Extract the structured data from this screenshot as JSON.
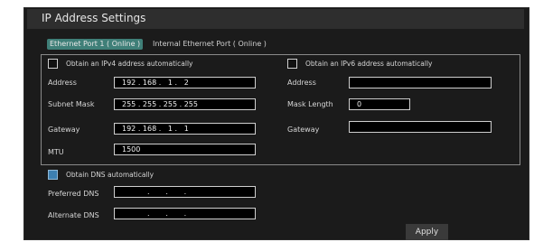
{
  "title": "IP Address Settings",
  "tabs": [
    {
      "label": "Ethernet Port 1 ( Online )",
      "active": true
    },
    {
      "label": "Internal Ethernet Port ( Online )",
      "active": false
    }
  ],
  "ipv4": {
    "auto_label": "Obtain an IPv4 address automatically",
    "auto_checked": false,
    "address_label": "Address",
    "address_value": "192 . 168 .   1 .   2",
    "mask_label": "Subnet Mask",
    "mask_value": "255 . 255 . 255 . 255",
    "gateway_label": "Gateway",
    "gateway_value": "192 . 168 .   1 .   1",
    "mtu_label": "MTU",
    "mtu_value": "1500"
  },
  "ipv6": {
    "auto_label": "Obtain an IPv6 address automatically",
    "auto_checked": false,
    "address_label": "Address",
    "address_value": "",
    "masklen_label": "Mask Length",
    "masklen_value": "0",
    "gateway_label": "Gateway",
    "gateway_value": ""
  },
  "dns": {
    "auto_label": "Obtain DNS automatically",
    "auto_checked": true,
    "preferred_label": "Preferred DNS",
    "preferred_value": "           .       .       .",
    "alternate_label": "Alternate DNS",
    "alternate_value": "           .       .       ."
  },
  "apply_label": "Apply",
  "colors": {
    "accent_tab": "#3f7f78",
    "panel_bg": "#1b1b1b",
    "checked": "#3d7fb0"
  }
}
